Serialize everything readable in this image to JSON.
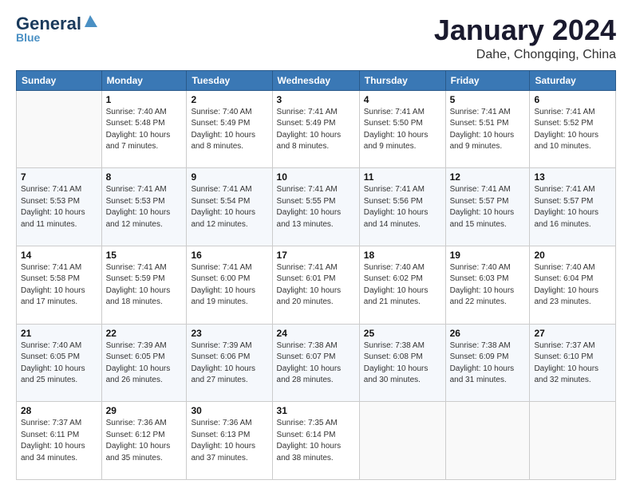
{
  "logo": {
    "general": "General",
    "blue": "Blue"
  },
  "header": {
    "month": "January 2024",
    "location": "Dahe, Chongqing, China"
  },
  "days_of_week": [
    "Sunday",
    "Monday",
    "Tuesday",
    "Wednesday",
    "Thursday",
    "Friday",
    "Saturday"
  ],
  "weeks": [
    [
      {
        "day": "",
        "info": ""
      },
      {
        "day": "1",
        "info": "Sunrise: 7:40 AM\nSunset: 5:48 PM\nDaylight: 10 hours\nand 7 minutes."
      },
      {
        "day": "2",
        "info": "Sunrise: 7:40 AM\nSunset: 5:49 PM\nDaylight: 10 hours\nand 8 minutes."
      },
      {
        "day": "3",
        "info": "Sunrise: 7:41 AM\nSunset: 5:49 PM\nDaylight: 10 hours\nand 8 minutes."
      },
      {
        "day": "4",
        "info": "Sunrise: 7:41 AM\nSunset: 5:50 PM\nDaylight: 10 hours\nand 9 minutes."
      },
      {
        "day": "5",
        "info": "Sunrise: 7:41 AM\nSunset: 5:51 PM\nDaylight: 10 hours\nand 9 minutes."
      },
      {
        "day": "6",
        "info": "Sunrise: 7:41 AM\nSunset: 5:52 PM\nDaylight: 10 hours\nand 10 minutes."
      }
    ],
    [
      {
        "day": "7",
        "info": "Sunrise: 7:41 AM\nSunset: 5:53 PM\nDaylight: 10 hours\nand 11 minutes."
      },
      {
        "day": "8",
        "info": "Sunrise: 7:41 AM\nSunset: 5:53 PM\nDaylight: 10 hours\nand 12 minutes."
      },
      {
        "day": "9",
        "info": "Sunrise: 7:41 AM\nSunset: 5:54 PM\nDaylight: 10 hours\nand 12 minutes."
      },
      {
        "day": "10",
        "info": "Sunrise: 7:41 AM\nSunset: 5:55 PM\nDaylight: 10 hours\nand 13 minutes."
      },
      {
        "day": "11",
        "info": "Sunrise: 7:41 AM\nSunset: 5:56 PM\nDaylight: 10 hours\nand 14 minutes."
      },
      {
        "day": "12",
        "info": "Sunrise: 7:41 AM\nSunset: 5:57 PM\nDaylight: 10 hours\nand 15 minutes."
      },
      {
        "day": "13",
        "info": "Sunrise: 7:41 AM\nSunset: 5:57 PM\nDaylight: 10 hours\nand 16 minutes."
      }
    ],
    [
      {
        "day": "14",
        "info": "Sunrise: 7:41 AM\nSunset: 5:58 PM\nDaylight: 10 hours\nand 17 minutes."
      },
      {
        "day": "15",
        "info": "Sunrise: 7:41 AM\nSunset: 5:59 PM\nDaylight: 10 hours\nand 18 minutes."
      },
      {
        "day": "16",
        "info": "Sunrise: 7:41 AM\nSunset: 6:00 PM\nDaylight: 10 hours\nand 19 minutes."
      },
      {
        "day": "17",
        "info": "Sunrise: 7:41 AM\nSunset: 6:01 PM\nDaylight: 10 hours\nand 20 minutes."
      },
      {
        "day": "18",
        "info": "Sunrise: 7:40 AM\nSunset: 6:02 PM\nDaylight: 10 hours\nand 21 minutes."
      },
      {
        "day": "19",
        "info": "Sunrise: 7:40 AM\nSunset: 6:03 PM\nDaylight: 10 hours\nand 22 minutes."
      },
      {
        "day": "20",
        "info": "Sunrise: 7:40 AM\nSunset: 6:04 PM\nDaylight: 10 hours\nand 23 minutes."
      }
    ],
    [
      {
        "day": "21",
        "info": "Sunrise: 7:40 AM\nSunset: 6:05 PM\nDaylight: 10 hours\nand 25 minutes."
      },
      {
        "day": "22",
        "info": "Sunrise: 7:39 AM\nSunset: 6:05 PM\nDaylight: 10 hours\nand 26 minutes."
      },
      {
        "day": "23",
        "info": "Sunrise: 7:39 AM\nSunset: 6:06 PM\nDaylight: 10 hours\nand 27 minutes."
      },
      {
        "day": "24",
        "info": "Sunrise: 7:38 AM\nSunset: 6:07 PM\nDaylight: 10 hours\nand 28 minutes."
      },
      {
        "day": "25",
        "info": "Sunrise: 7:38 AM\nSunset: 6:08 PM\nDaylight: 10 hours\nand 30 minutes."
      },
      {
        "day": "26",
        "info": "Sunrise: 7:38 AM\nSunset: 6:09 PM\nDaylight: 10 hours\nand 31 minutes."
      },
      {
        "day": "27",
        "info": "Sunrise: 7:37 AM\nSunset: 6:10 PM\nDaylight: 10 hours\nand 32 minutes."
      }
    ],
    [
      {
        "day": "28",
        "info": "Sunrise: 7:37 AM\nSunset: 6:11 PM\nDaylight: 10 hours\nand 34 minutes."
      },
      {
        "day": "29",
        "info": "Sunrise: 7:36 AM\nSunset: 6:12 PM\nDaylight: 10 hours\nand 35 minutes."
      },
      {
        "day": "30",
        "info": "Sunrise: 7:36 AM\nSunset: 6:13 PM\nDaylight: 10 hours\nand 37 minutes."
      },
      {
        "day": "31",
        "info": "Sunrise: 7:35 AM\nSunset: 6:14 PM\nDaylight: 10 hours\nand 38 minutes."
      },
      {
        "day": "",
        "info": ""
      },
      {
        "day": "",
        "info": ""
      },
      {
        "day": "",
        "info": ""
      }
    ]
  ]
}
